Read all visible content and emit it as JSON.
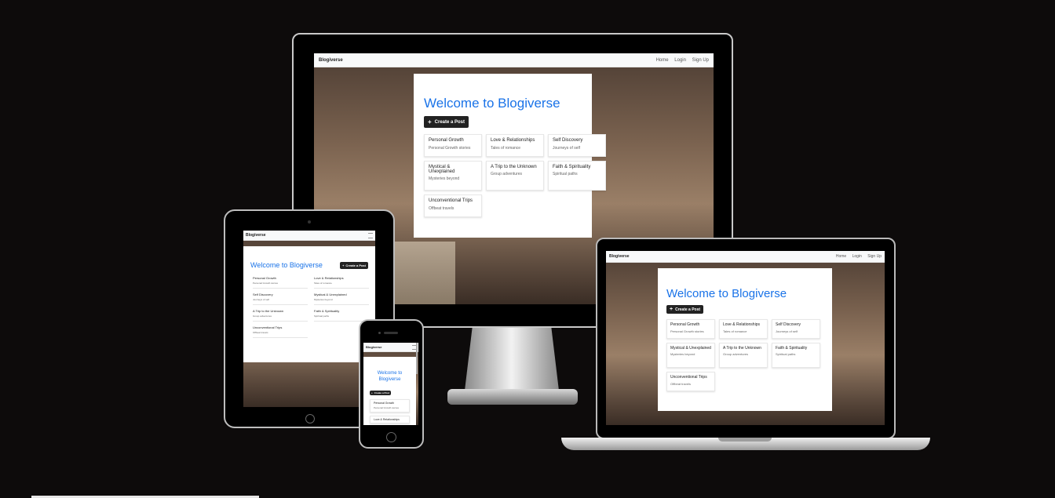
{
  "brand": "Blogiverse",
  "nav_links": [
    "Home",
    "Login",
    "Sign Up"
  ],
  "welcome": "Welcome to Blogiverse",
  "create_btn": "Create a Post",
  "plus": "+",
  "categories": [
    {
      "title": "Personal Growth",
      "desc": "Personal Growth stories"
    },
    {
      "title": "Love & Relationships",
      "desc": "Tales of romance"
    },
    {
      "title": "Self Discovery",
      "desc": "Journeys of self"
    },
    {
      "title": "Mystical & Unexplained",
      "desc": "Mysteries beyond"
    },
    {
      "title": "A Trip to the Unknown",
      "desc": "Group adventures"
    },
    {
      "title": "Faith & Spirituality",
      "desc": "Spiritual paths"
    },
    {
      "title": "Unconventional Trips",
      "desc": "Offbeat travels"
    }
  ],
  "colors": {
    "accent": "#1a73e8",
    "button": "#222222",
    "page_bg": "#0d0b0b"
  },
  "icons": {
    "menu": "hamburger-menu-icon"
  }
}
